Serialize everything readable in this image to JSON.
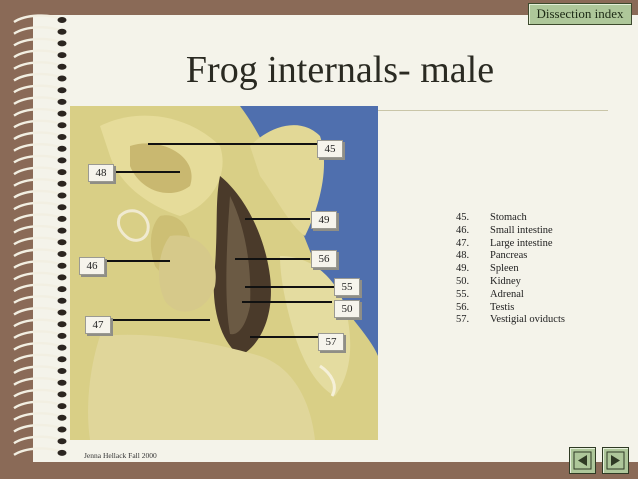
{
  "nav": {
    "index_label": "Dissection index"
  },
  "slide": {
    "title": "Frog internals- male"
  },
  "photo": {
    "callouts": [
      {
        "num": "45"
      },
      {
        "num": "48"
      },
      {
        "num": "49"
      },
      {
        "num": "56"
      },
      {
        "num": "46"
      },
      {
        "num": "55"
      },
      {
        "num": "50"
      },
      {
        "num": "47"
      },
      {
        "num": "57"
      }
    ]
  },
  "legend": [
    {
      "num": "45.",
      "label": "Stomach"
    },
    {
      "num": "46.",
      "label": "Small intestine"
    },
    {
      "num": "47.",
      "label": "Large intestine"
    },
    {
      "num": "48.",
      "label": "Pancreas"
    },
    {
      "num": "49.",
      "label": "Spleen"
    },
    {
      "num": "50.",
      "label": "Kidney"
    },
    {
      "num": "55.",
      "label": "Adrenal"
    },
    {
      "num": "56.",
      "label": "Testis"
    },
    {
      "num": "57.",
      "label": "Vestigial oviducts"
    }
  ],
  "footer": {
    "credit": "Jenna Hellack Fall 2000"
  },
  "icons": {
    "back": "back-arrow-icon",
    "forward": "forward-arrow-icon"
  },
  "colors": {
    "frame": "#8a6a57",
    "slide_bg": "#f4f3ea",
    "button_green": "#aec79a",
    "photo_bg": "#4f6fae"
  }
}
